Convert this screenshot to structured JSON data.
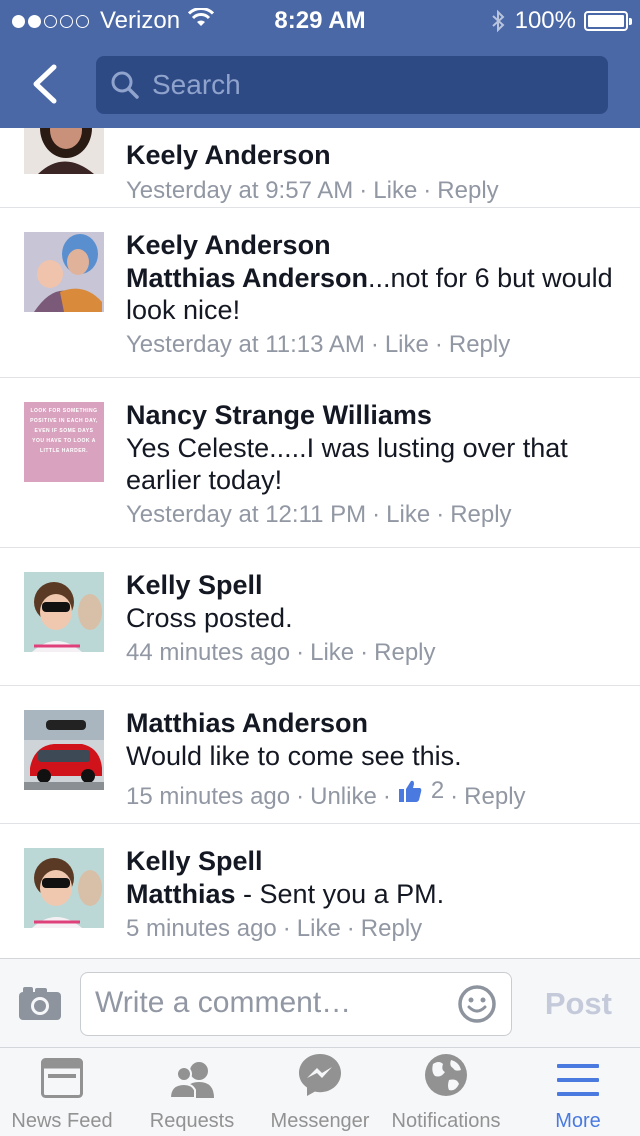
{
  "status_bar": {
    "carrier": "Verizon",
    "time": "8:29 AM",
    "battery": "100%"
  },
  "nav": {
    "search_placeholder": "Search"
  },
  "comments": [
    {
      "name": "Keely Anderson",
      "text_prefix": "",
      "text": "",
      "time": "Yesterday at 9:57 AM",
      "like": "Like",
      "reply": "Reply"
    },
    {
      "name": "Keely Anderson",
      "text_prefix": "Matthias Anderson",
      "text": "...not for 6 but would look nice!",
      "time": "Yesterday at 11:13 AM",
      "like": "Like",
      "reply": "Reply"
    },
    {
      "name": "Nancy Strange Williams",
      "text_prefix": "",
      "text": "Yes Celeste.....I was lusting over that earlier today!",
      "time": "Yesterday at 12:11 PM",
      "like": "Like",
      "reply": "Reply",
      "avatar_text": "LOOK FOR SOMETHING POSITIVE IN EACH DAY, EVEN IF SOME DAYS YOU HAVE TO LOOK A LITTLE HARDER."
    },
    {
      "name": "Kelly Spell",
      "text_prefix": "",
      "text": "Cross posted.",
      "time": "44 minutes ago",
      "like": "Like",
      "reply": "Reply"
    },
    {
      "name": "Matthias Anderson",
      "text_prefix": "",
      "text": "Would like to come see this.",
      "time": "15 minutes ago",
      "like": "Unlike",
      "like_count": "2",
      "reply": "Reply"
    },
    {
      "name": "Kelly Spell",
      "text_prefix": "Matthias",
      "text": " - Sent you a PM.",
      "time": "5 minutes ago",
      "like": "Like",
      "reply": "Reply"
    }
  ],
  "composer": {
    "placeholder": "Write a comment…",
    "post_label": "Post"
  },
  "tabbar": {
    "items": [
      {
        "label": "News Feed",
        "icon": "news-feed-icon"
      },
      {
        "label": "Requests",
        "icon": "friend-requests-icon"
      },
      {
        "label": "Messenger",
        "icon": "messenger-icon"
      },
      {
        "label": "Notifications",
        "icon": "globe-icon"
      },
      {
        "label": "More",
        "icon": "hamburger-menu-icon",
        "active": true
      }
    ]
  },
  "colors": {
    "header_blue": "#4a67a6",
    "search_bg": "#2e4a85",
    "active_tab": "#4a7ae0",
    "meta_gray": "#9197a3"
  }
}
